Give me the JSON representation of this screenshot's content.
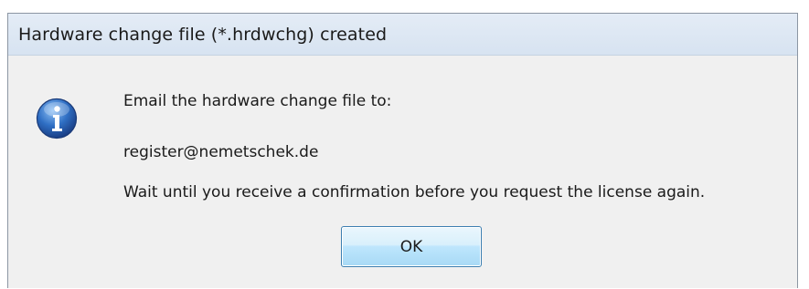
{
  "dialog": {
    "title": "Hardware change file (*.hrdwchg) created",
    "icon": "info-icon",
    "message_line_1": "Email the hardware change file to:",
    "message_line_2": "register@nemetschek.de",
    "message_line_3": "Wait until you receive a confirmation before you request the license again.",
    "ok_label": "OK"
  },
  "colors": {
    "icon_blue": "#2f6fc4",
    "button_border": "#3c7fb1"
  }
}
